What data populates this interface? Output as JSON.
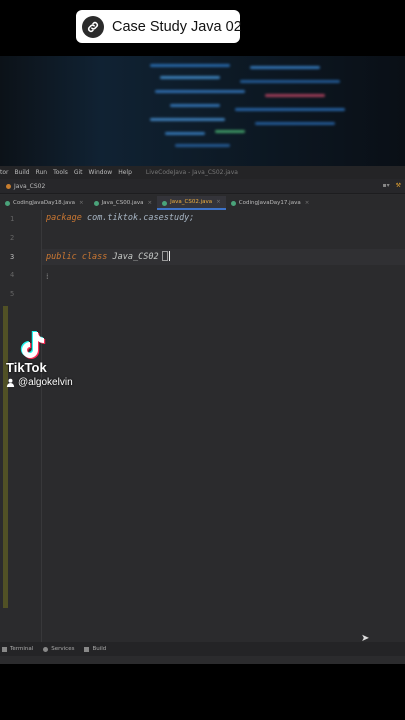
{
  "link_chip": {
    "label": "Case Study Java 02",
    "icon": "link-icon"
  },
  "ide": {
    "menubar": {
      "items": [
        "tor",
        "Build",
        "Run",
        "Tools",
        "Git",
        "Window",
        "Help"
      ],
      "window_title": "LiveCodeJava - Java_CS02.java"
    },
    "navbar": {
      "breadcrumb": "Java_CS02"
    },
    "tabs": [
      {
        "label": "CodingJavaDay18.java",
        "active": false
      },
      {
        "label": "Java_CS00.java",
        "active": false
      },
      {
        "label": "Java_CS02.java",
        "active": true
      },
      {
        "label": "CodingJavaDay17.java",
        "active": false
      }
    ],
    "editor": {
      "line_numbers": [
        "1",
        "2",
        "3",
        "4",
        "5"
      ],
      "current_line": "3",
      "line1": {
        "keyword": "package",
        "text": "com.tiktok.casestudy;"
      },
      "line3": {
        "keyword": "public class",
        "text": "Java_CS02"
      }
    },
    "statusbar": {
      "terminal": "Terminal",
      "services": "Services",
      "build": "Build"
    }
  },
  "watermark": {
    "brand": "TikTok",
    "handle": "@algokelvin"
  },
  "colors": {
    "keyword": "#cc7832",
    "active_tab_text": "#f0b040",
    "active_tab_underline": "#3d73c9",
    "editor_bg": "#2b2b2d"
  }
}
